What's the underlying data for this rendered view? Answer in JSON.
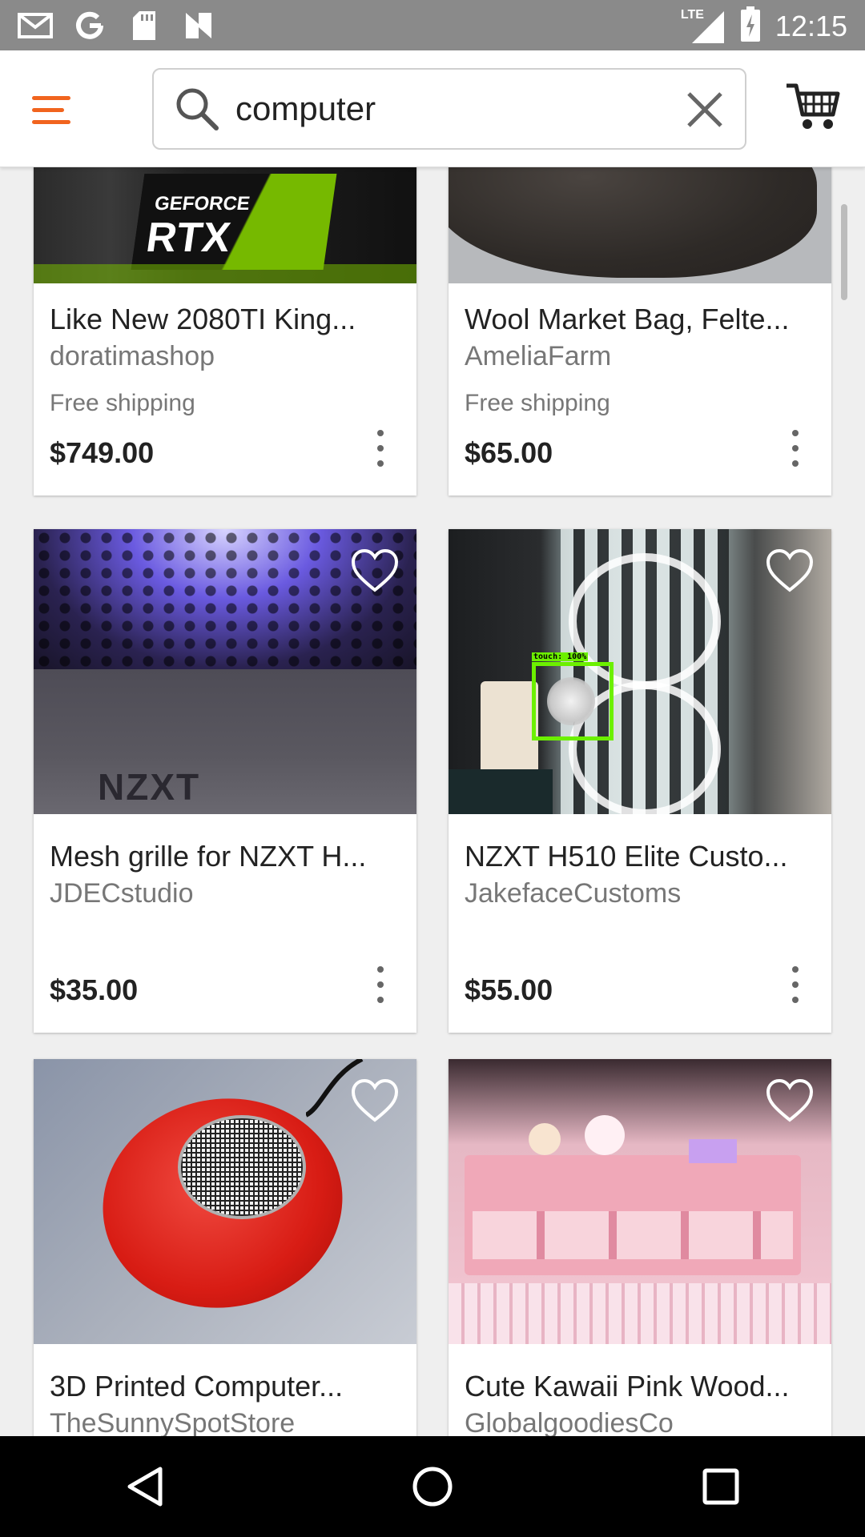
{
  "status_bar": {
    "time": "12:15",
    "network": "LTE",
    "icons": [
      "gmail-icon",
      "google-icon",
      "sd-card-icon",
      "nfc-icon",
      "signal-icon",
      "battery-icon"
    ]
  },
  "search": {
    "query": "computer"
  },
  "accent_color": "#f1641e",
  "products": [
    {
      "title": "Like New 2080TI King...",
      "shop": "doratimashop",
      "shipping": "Free shipping",
      "price": "$749.00",
      "image": "geforce-rtx-image"
    },
    {
      "title": "Wool Market Bag, Felte...",
      "shop": "AmeliaFarm",
      "shipping": "Free shipping",
      "price": "$65.00",
      "image": "wool-bag-image"
    },
    {
      "title": "Mesh grille for NZXT H...",
      "shop": "JDECstudio",
      "shipping": "",
      "price": "$35.00",
      "image": "nzxt-mesh-image",
      "image_text": "NZXT"
    },
    {
      "title": "NZXT H510 Elite Custo...",
      "shop": "JakefaceCustoms",
      "shipping": "",
      "price": "$55.00",
      "image": "nzxt-case-image",
      "detect_label": "touch: 100%"
    },
    {
      "title": "3D Printed Computer...",
      "shop": "TheSunnySpotStore",
      "shipping": "",
      "price": "",
      "image": "red-speaker-image"
    },
    {
      "title": "Cute Kawaii Pink Wood...",
      "shop": "GlobalgoodiesCo",
      "shipping": "",
      "price": "",
      "image": "pink-desk-image"
    }
  ]
}
